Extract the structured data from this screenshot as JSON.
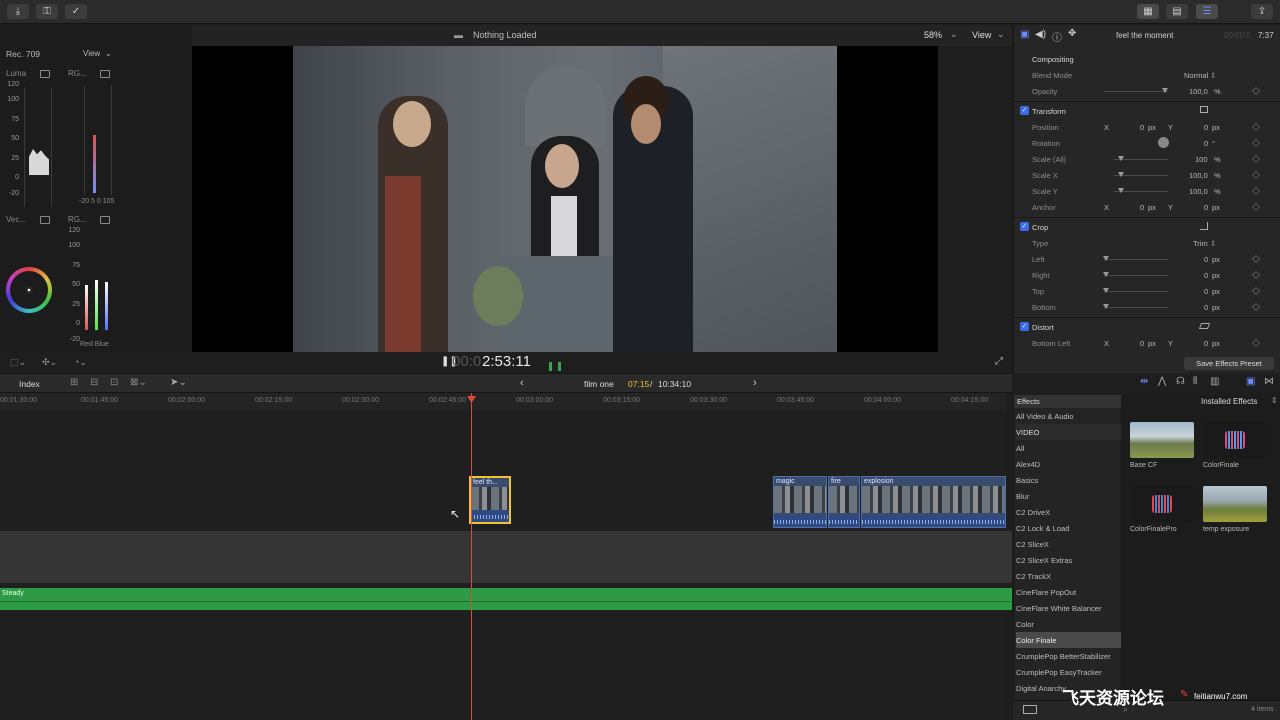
{
  "topbar": {
    "left_icons": [
      "import-icon",
      "key-icon",
      "check-icon"
    ],
    "right_icons": [
      "browser-view-icon",
      "timeline-view-icon",
      "inspector-toggle-icon",
      "share-icon"
    ]
  },
  "scopes": {
    "color_space": "Rec. 709",
    "view_label": "View",
    "luma": {
      "label": "Luma",
      "ticks": [
        "120",
        "100",
        "75",
        "50",
        "25",
        "0",
        "-20"
      ]
    },
    "rgb_parade": {
      "label": "RG...",
      "bottom": "-20 5 0 105"
    },
    "vectorscope": {
      "label": "Vec..."
    },
    "rgb_parade2": {
      "label": "RG...",
      "ticks": [
        "120",
        "100",
        "75",
        "50",
        "25",
        "0",
        "-20"
      ],
      "bottom": "Red Blue"
    }
  },
  "viewer": {
    "title": "Nothing Loaded",
    "zoom": "58%",
    "view_label": "View",
    "timecode_dim": "00:0",
    "timecode": "2:53:11"
  },
  "inspector": {
    "clip_name": "feel the moment",
    "duration_dim": "00:00:0",
    "duration": "7:37",
    "compositing": {
      "title": "Compositing",
      "blend_mode_label": "Blend Mode",
      "blend_mode": "Normal",
      "opacity_label": "Opacity",
      "opacity": "100,0",
      "opacity_unit": "%"
    },
    "transform": {
      "title": "Transform",
      "rows": [
        {
          "label": "Position",
          "x": "0",
          "y": "0",
          "unit": "px"
        },
        {
          "label": "Rotation",
          "value": "0",
          "unit": "°"
        },
        {
          "label": "Scale (All)",
          "value": "100",
          "unit": "%"
        },
        {
          "label": "Scale X",
          "value": "100,0",
          "unit": "%"
        },
        {
          "label": "Scale Y",
          "value": "100,0",
          "unit": "%"
        },
        {
          "label": "Anchor",
          "x": "0",
          "y": "0",
          "unit": "px"
        }
      ]
    },
    "crop": {
      "title": "Crop",
      "type_label": "Type",
      "type": "Trim",
      "rows": [
        {
          "label": "Left",
          "value": "0",
          "unit": "px"
        },
        {
          "label": "Right",
          "value": "0",
          "unit": "px"
        },
        {
          "label": "Top",
          "value": "0",
          "unit": "px"
        },
        {
          "label": "Bottom",
          "value": "0",
          "unit": "px"
        }
      ]
    },
    "distort": {
      "title": "Distort",
      "row": {
        "label": "Bottom Left",
        "x": "0",
        "y": "0",
        "unit": "px"
      }
    },
    "x_label": "X",
    "y_label": "Y",
    "save_preset": "Save Effects Preset"
  },
  "timeline": {
    "index_label": "Index",
    "project_name": "film one",
    "position": "07:15",
    "total": "10:34:10",
    "ruler_ticks": [
      "00:01:30:00",
      "00:01:45:00",
      "00:02:00:00",
      "00:02:15:00",
      "00:02:30:00",
      "00:02:45:00",
      "00:03:00:00",
      "00:03:15:00",
      "00:03:30:00",
      "00:03:45:00",
      "00:04:00:00",
      "00:04:15:00"
    ],
    "clips": {
      "selected": "feel th...",
      "c1": "magic",
      "c2": "fire",
      "c3": "explosion"
    },
    "audio_track": "Steady"
  },
  "effects": {
    "title": "Effects",
    "installed": "Installed Effects",
    "count": "4 items",
    "categories": [
      "All Video & Audio",
      "VIDEO",
      "All",
      "Alex4D",
      "Basics",
      "Blur",
      "C2 DriveX",
      "C2 Lock & Load",
      "C2 SliceX",
      "C2 SliceX Extras",
      "C2 TrackX",
      "CineFlare PopOut",
      "CineFlare White Balancer",
      "Color",
      "Color Finale",
      "CrumplePop BetterStabilizer",
      "CrumplePop EasyTracker",
      "Digital Anarchy"
    ],
    "selected_category": "Color Finale",
    "items": [
      "Base CF",
      "ColorFinale",
      "ColorFinalePro",
      "temp exposure"
    ]
  },
  "watermark": {
    "cn": "飞天资源论坛",
    "url": "feitianwu7.com"
  },
  "colors": {
    "accent": "#3b6cf0",
    "playhead": "#e0483a",
    "audio": "#2d9a45",
    "clip_selected_border": "#f2c230",
    "timecode_yellow": "#f2c230"
  }
}
